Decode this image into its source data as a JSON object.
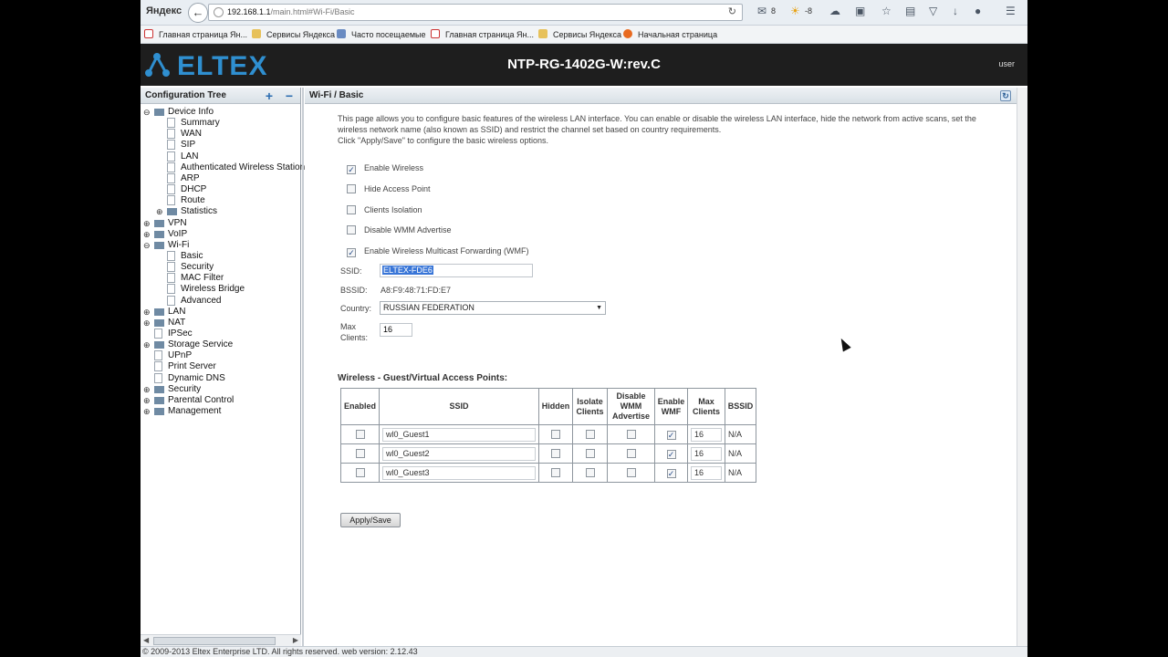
{
  "browser": {
    "brand": "Яндекс",
    "url_host": "192.168.1.1",
    "url_path": "/main.html#Wi-Fi/Basic",
    "mail_count": "8",
    "weather": "-8"
  },
  "bookmarks": [
    {
      "label": "Главная страница Ян...",
      "icon": "yandex-icon"
    },
    {
      "label": "Сервисы Яндекса",
      "icon": "folder-icon"
    },
    {
      "label": "Часто посещаемые",
      "icon": "frequent-icon"
    },
    {
      "label": "Главная страница Ян...",
      "icon": "yandex-icon"
    },
    {
      "label": "Сервисы Яндекса",
      "icon": "folder-icon"
    },
    {
      "label": "Начальная страница",
      "icon": "firefox-icon"
    }
  ],
  "header": {
    "logo_text": "ELTEX",
    "device_title": "NTP-RG-1402G-W:rev.C",
    "user": "user"
  },
  "tree": {
    "title": "Configuration Tree",
    "items": [
      {
        "label": "Device Info",
        "type": "folder",
        "level": 0,
        "toggle": "−"
      },
      {
        "label": "Summary",
        "type": "page",
        "level": 1
      },
      {
        "label": "WAN",
        "type": "page",
        "level": 1
      },
      {
        "label": "SIP",
        "type": "page",
        "level": 1
      },
      {
        "label": "LAN",
        "type": "page",
        "level": 1
      },
      {
        "label": "Authenticated Wireless Station",
        "type": "page",
        "level": 1
      },
      {
        "label": "ARP",
        "type": "page",
        "level": 1
      },
      {
        "label": "DHCP",
        "type": "page",
        "level": 1
      },
      {
        "label": "Route",
        "type": "page",
        "level": 1
      },
      {
        "label": "Statistics",
        "type": "folder",
        "level": 1,
        "toggle": "+"
      },
      {
        "label": "VPN",
        "type": "folder",
        "level": 0,
        "toggle": "+"
      },
      {
        "label": "VoIP",
        "type": "folder",
        "level": 0,
        "toggle": "+"
      },
      {
        "label": "Wi-Fi",
        "type": "folder",
        "level": 0,
        "toggle": "−"
      },
      {
        "label": "Basic",
        "type": "page",
        "level": 1
      },
      {
        "label": "Security",
        "type": "page",
        "level": 1
      },
      {
        "label": "MAC Filter",
        "type": "page",
        "level": 1
      },
      {
        "label": "Wireless Bridge",
        "type": "page",
        "level": 1
      },
      {
        "label": "Advanced",
        "type": "page",
        "level": 1
      },
      {
        "label": "LAN",
        "type": "folder",
        "level": 0,
        "toggle": "+"
      },
      {
        "label": "NAT",
        "type": "folder",
        "level": 0,
        "toggle": "+"
      },
      {
        "label": "IPSec",
        "type": "page",
        "level": 0
      },
      {
        "label": "Storage Service",
        "type": "folder",
        "level": 0,
        "toggle": "+"
      },
      {
        "label": "UPnP",
        "type": "page",
        "level": 0
      },
      {
        "label": "Print Server",
        "type": "page",
        "level": 0
      },
      {
        "label": "Dynamic DNS",
        "type": "page",
        "level": 0
      },
      {
        "label": "Security",
        "type": "folder",
        "level": 0,
        "toggle": "+"
      },
      {
        "label": "Parental Control",
        "type": "folder",
        "level": 0,
        "toggle": "+"
      },
      {
        "label": "Management",
        "type": "folder",
        "level": 0,
        "toggle": "+"
      }
    ]
  },
  "main": {
    "title": "Wi-Fi / Basic",
    "intro": "This page allows you to configure basic features of the wireless LAN interface. You can enable or disable the wireless LAN interface, hide the network from active scans, set the wireless network name (also known as SSID) and restrict the channel set based on country requirements.",
    "intro2": "Click \"Apply/Save\" to configure the basic wireless options.",
    "options": [
      {
        "label": "Enable Wireless",
        "checked": true
      },
      {
        "label": "Hide Access Point",
        "checked": false
      },
      {
        "label": "Clients Isolation",
        "checked": false
      },
      {
        "label": "Disable WMM Advertise",
        "checked": false
      },
      {
        "label": "Enable Wireless Multicast Forwarding (WMF)",
        "checked": true
      }
    ],
    "ssid_label": "SSID:",
    "ssid_value": "ELTEX-FDE6",
    "bssid_label": "BSSID:",
    "bssid_value": "A8:F9:48:71:FD:E7",
    "country_label": "Country:",
    "country_value": "RUSSIAN FEDERATION",
    "max_clients_label_1": "Max",
    "max_clients_label_2": "Clients:",
    "max_clients_value": "16",
    "guest_title": "Wireless - Guest/Virtual Access Points:",
    "guest_columns": [
      "Enabled",
      "SSID",
      "Hidden",
      "Isolate Clients",
      "Disable WMM Advertise",
      "Enable WMF",
      "Max Clients",
      "BSSID"
    ],
    "guest_rows": [
      {
        "enabled": false,
        "ssid": "wl0_Guest1",
        "hidden": false,
        "isolate": false,
        "wmm": false,
        "wmf": true,
        "max": "16",
        "bssid": "N/A"
      },
      {
        "enabled": false,
        "ssid": "wl0_Guest2",
        "hidden": false,
        "isolate": false,
        "wmm": false,
        "wmf": true,
        "max": "16",
        "bssid": "N/A"
      },
      {
        "enabled": false,
        "ssid": "wl0_Guest3",
        "hidden": false,
        "isolate": false,
        "wmm": false,
        "wmf": true,
        "max": "16",
        "bssid": "N/A"
      }
    ],
    "apply_label": "Apply/Save"
  },
  "footer": "© 2009-2013 Eltex Enterprise LTD. All rights reserved. web version: 2.12.43",
  "colors": {
    "header_bg": "#1e1e1e",
    "logo": "#2f8fd0",
    "selection": "#3875d7"
  }
}
